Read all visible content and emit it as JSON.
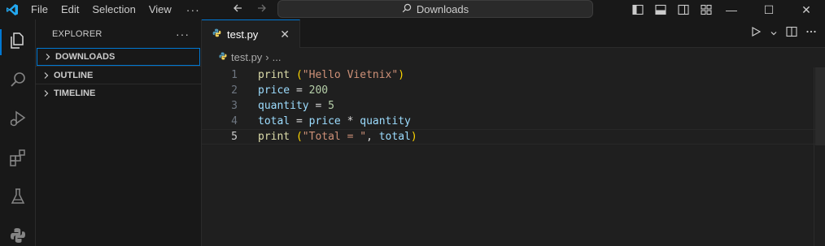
{
  "titlebar": {
    "menu": [
      "File",
      "Edit",
      "Selection",
      "View"
    ],
    "menu_more": "···",
    "search_text": "Downloads"
  },
  "window_controls": {
    "minimize": "—",
    "maximize": "☐",
    "close": "✕"
  },
  "sidebar": {
    "title": "EXPLORER",
    "more": "···",
    "sections": [
      "DOWNLOADS",
      "OUTLINE",
      "TIMELINE"
    ]
  },
  "editor": {
    "tab": {
      "label": "test.py",
      "close": "✕"
    },
    "breadcrumbs": {
      "file": "test.py",
      "separator": "›",
      "more": "..."
    },
    "current_line": 5,
    "lines": [
      {
        "number": "1",
        "tokens": [
          {
            "t": "print",
            "c": "func"
          },
          {
            "t": " ",
            "c": "op"
          },
          {
            "t": "(",
            "c": "paren"
          },
          {
            "t": "\"Hello Vietnix\"",
            "c": "str"
          },
          {
            "t": ")",
            "c": "paren"
          }
        ]
      },
      {
        "number": "2",
        "tokens": [
          {
            "t": "price",
            "c": "var"
          },
          {
            "t": " = ",
            "c": "op"
          },
          {
            "t": "200",
            "c": "num"
          }
        ]
      },
      {
        "number": "3",
        "tokens": [
          {
            "t": "quantity",
            "c": "var"
          },
          {
            "t": " = ",
            "c": "op"
          },
          {
            "t": "5",
            "c": "num"
          }
        ]
      },
      {
        "number": "4",
        "tokens": [
          {
            "t": "total",
            "c": "var"
          },
          {
            "t": " = ",
            "c": "op"
          },
          {
            "t": "price",
            "c": "var"
          },
          {
            "t": " * ",
            "c": "op"
          },
          {
            "t": "quantity",
            "c": "var"
          }
        ]
      },
      {
        "number": "5",
        "tokens": [
          {
            "t": "print",
            "c": "func"
          },
          {
            "t": " ",
            "c": "op"
          },
          {
            "t": "(",
            "c": "paren"
          },
          {
            "t": "\"Total = \"",
            "c": "str"
          },
          {
            "t": ", ",
            "c": "op"
          },
          {
            "t": "total",
            "c": "var"
          },
          {
            "t": ")",
            "c": "paren"
          }
        ]
      }
    ]
  },
  "colors": {
    "accent": "#0078d4",
    "function": "#dcdcaa",
    "variable": "#9cdcfe",
    "string": "#ce9178",
    "number": "#b5cea8",
    "bracket": "#ffd700"
  },
  "icons": {
    "app": "vscode-logo-icon",
    "activity": [
      "files-icon",
      "search-icon",
      "run-debug-icon",
      "extensions-icon",
      "testing-icon",
      "python-icon"
    ],
    "editor_actions": [
      "run-icon",
      "run-dropdown-icon",
      "split-editor-icon",
      "more-actions-icon"
    ],
    "layout": [
      "toggle-primary-sidebar-icon",
      "toggle-panel-icon",
      "toggle-secondary-sidebar-icon",
      "customize-layout-icon"
    ]
  }
}
